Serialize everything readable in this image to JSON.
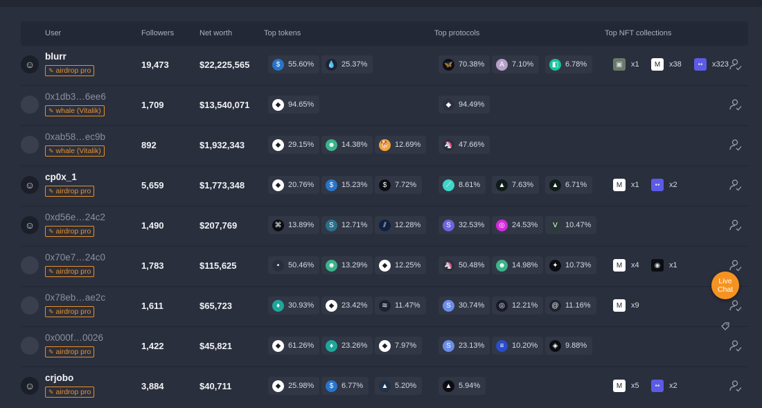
{
  "headers": {
    "user": "User",
    "followers": "Followers",
    "net_worth": "Net worth",
    "top_tokens": "Top tokens",
    "top_protocols": "Top protocols",
    "top_nft": "Top NFT collections"
  },
  "rows": [
    {
      "user": "blurr",
      "style": "strong",
      "avatar": "img",
      "tag": "airdrop pro",
      "followers": "19,473",
      "net_worth": "$22,225,565",
      "tokens": [
        {
          "icon": "usdc-icon",
          "glyph": "$",
          "color": "#2775ca",
          "pct": "55.60%"
        },
        {
          "icon": "drop-icon",
          "glyph": "💧",
          "color": "#1e2433",
          "pct": "25.37%"
        }
      ],
      "protocols": [
        {
          "icon": "butterfly-icon",
          "glyph": "🦋",
          "color": "#0b0d12",
          "pct": "70.38%"
        },
        {
          "icon": "aave-icon",
          "glyph": "A",
          "color": "#b6a0c8",
          "pct": "7.10%"
        },
        {
          "icon": "protocol-green-icon",
          "glyph": "◧",
          "color": "#12c49a",
          "pct": "6.78%"
        }
      ],
      "nfts": [
        {
          "icon": "nft-portrait-icon",
          "glyph": "▣",
          "color": "#6a7a6a",
          "count": "x1"
        },
        {
          "icon": "nft-m-icon",
          "glyph": "M",
          "color": "#ffffff",
          "count": "x38"
        },
        {
          "icon": "nft-eyes-icon",
          "glyph": "••",
          "color": "#5b5be8",
          "count": "x323"
        }
      ]
    },
    {
      "user": "0x1db3…6ee6",
      "style": "addr",
      "avatar": "plain",
      "tag": "whale (Vitalik)",
      "followers": "1,709",
      "net_worth": "$13,540,071",
      "tokens": [
        {
          "icon": "eth-icon",
          "glyph": "◆",
          "color": "#ffffff",
          "pct": "94.65%"
        }
      ],
      "protocols": [
        {
          "icon": "eth-color-icon",
          "glyph": "◆",
          "color": "#2c3040",
          "pct": "94.49%"
        }
      ],
      "nfts": []
    },
    {
      "user": "0xab58…ec9b",
      "style": "addr",
      "avatar": "plain",
      "tag": "whale (Vitalik)",
      "followers": "892",
      "net_worth": "$1,932,343",
      "tokens": [
        {
          "icon": "eth-icon",
          "glyph": "◆",
          "color": "#ffffff",
          "pct": "29.15%"
        },
        {
          "icon": "frog-icon",
          "glyph": "☻",
          "color": "#3bb38a",
          "pct": "14.38%"
        },
        {
          "icon": "shib-icon",
          "glyph": "🐕",
          "color": "#f2a33a",
          "pct": "12.69%"
        }
      ],
      "protocols": [
        {
          "icon": "unicorn-icon",
          "glyph": "🦄",
          "color": "#2a2f3d",
          "pct": "47.66%"
        }
      ],
      "nfts": []
    },
    {
      "user": "cp0x_1",
      "style": "strong",
      "avatar": "img",
      "tag": "airdrop pro",
      "followers": "5,659",
      "net_worth": "$1,773,348",
      "tokens": [
        {
          "icon": "eth-icon",
          "glyph": "◆",
          "color": "#ffffff",
          "pct": "20.76%"
        },
        {
          "icon": "usdc-icon",
          "glyph": "$",
          "color": "#2775ca",
          "pct": "15.23%"
        },
        {
          "icon": "dollar-icon",
          "glyph": "$",
          "color": "#0b0d12",
          "pct": "7.72%"
        }
      ],
      "protocols": [
        {
          "icon": "feather-icon",
          "glyph": "⟋",
          "color": "#3fd5c8",
          "pct": "8.61%"
        },
        {
          "icon": "mountain-icon",
          "glyph": "▲",
          "color": "#0e1c1a",
          "pct": "7.63%"
        },
        {
          "icon": "mountain-icon",
          "glyph": "▲",
          "color": "#0e1c1a",
          "pct": "6.71%"
        }
      ],
      "nfts": [
        {
          "icon": "nft-m-icon",
          "glyph": "M",
          "color": "#ffffff",
          "count": "x1"
        },
        {
          "icon": "nft-eyes-icon",
          "glyph": "••",
          "color": "#5b5be8",
          "count": "x2"
        }
      ]
    },
    {
      "user": "0xd56e…24c2",
      "style": "addr",
      "avatar": "img",
      "tag": "airdrop pro",
      "followers": "1,490",
      "net_worth": "$207,769",
      "tokens": [
        {
          "icon": "square-logo-icon",
          "glyph": "⌘",
          "color": "#0b0d12",
          "pct": "13.89%"
        },
        {
          "icon": "s-token-icon",
          "glyph": "S",
          "color": "#2a6f8a",
          "pct": "12.71%"
        },
        {
          "icon": "stripe-token-icon",
          "glyph": "⫽",
          "color": "#102040",
          "pct": "12.28%"
        }
      ],
      "protocols": [
        {
          "icon": "purple-s-icon",
          "glyph": "S",
          "color": "#6f63e0",
          "pct": "32.53%"
        },
        {
          "icon": "magenta-icon",
          "glyph": "◎",
          "color": "#d12ad8",
          "pct": "24.53%"
        },
        {
          "icon": "vue-icon",
          "glyph": "V",
          "color": "#2a3a38",
          "pct": "10.47%"
        }
      ],
      "nfts": []
    },
    {
      "user": "0x70e7…24c0",
      "style": "addr",
      "avatar": "plain",
      "tag": "airdrop pro",
      "followers": "1,783",
      "net_worth": "$115,625",
      "tokens": [
        {
          "icon": "dark-token-icon",
          "glyph": "•",
          "color": "#2a2f3d",
          "pct": "50.46%"
        },
        {
          "icon": "frog-icon",
          "glyph": "☻",
          "color": "#3bb38a",
          "pct": "13.29%"
        },
        {
          "icon": "eth-icon",
          "glyph": "◆",
          "color": "#ffffff",
          "pct": "12.25%"
        }
      ],
      "protocols": [
        {
          "icon": "unicorn-icon",
          "glyph": "🦄",
          "color": "#2a2f3d",
          "pct": "50.48%"
        },
        {
          "icon": "frog-icon",
          "glyph": "☻",
          "color": "#3bb38a",
          "pct": "14.98%"
        },
        {
          "icon": "wing-icon",
          "glyph": "✦",
          "color": "#0b0d12",
          "pct": "10.73%"
        }
      ],
      "nfts": [
        {
          "icon": "nft-m-icon",
          "glyph": "M",
          "color": "#ffffff",
          "count": "x4"
        },
        {
          "icon": "nft-mask-icon",
          "glyph": "◉",
          "color": "#0b0d12",
          "count": "x1"
        }
      ]
    },
    {
      "user": "0x78eb…ae2c",
      "style": "addr",
      "avatar": "plain",
      "tag": "airdrop pro",
      "followers": "1,611",
      "net_worth": "$65,723",
      "tokens": [
        {
          "icon": "gem-icon",
          "glyph": "♦",
          "color": "#1fa69a",
          "pct": "30.93%"
        },
        {
          "icon": "eth-icon",
          "glyph": "◆",
          "color": "#ffffff",
          "pct": "23.42%"
        },
        {
          "icon": "layers-icon",
          "glyph": "≋",
          "color": "#1e2230",
          "pct": "11.47%"
        }
      ],
      "protocols": [
        {
          "icon": "circle-s-icon",
          "glyph": "S",
          "color": "#6a8de8",
          "pct": "30.74%"
        },
        {
          "icon": "ring-icon",
          "glyph": "◎",
          "color": "#1a1a2e",
          "pct": "12.21%"
        },
        {
          "icon": "spiral-icon",
          "glyph": "@",
          "color": "#1e2230",
          "pct": "11.16%"
        }
      ],
      "nfts": [
        {
          "icon": "nft-m-icon",
          "glyph": "M",
          "color": "#ffffff",
          "count": "x9"
        }
      ]
    },
    {
      "user": "0x000f…0026",
      "style": "addr",
      "avatar": "plain",
      "tag": "airdrop pro",
      "followers": "1,422",
      "net_worth": "$45,821",
      "tokens": [
        {
          "icon": "eth-icon",
          "glyph": "◆",
          "color": "#ffffff",
          "pct": "61.26%"
        },
        {
          "icon": "gem-icon",
          "glyph": "♦",
          "color": "#1fa69a",
          "pct": "23.26%"
        },
        {
          "icon": "eth-icon",
          "glyph": "◆",
          "color": "#ffffff",
          "pct": "7.97%"
        }
      ],
      "protocols": [
        {
          "icon": "circle-s-icon",
          "glyph": "S",
          "color": "#6a8de8",
          "pct": "23.13%"
        },
        {
          "icon": "lines-icon",
          "glyph": "≡",
          "color": "#2a4cc8",
          "pct": "10.20%"
        },
        {
          "icon": "diamond-icon",
          "glyph": "◈",
          "color": "#0b0d12",
          "pct": "9.88%"
        }
      ],
      "nfts": []
    },
    {
      "user": "crjobo",
      "style": "strong",
      "avatar": "img",
      "tag": "airdrop pro",
      "followers": "3,884",
      "net_worth": "$40,711",
      "tokens": [
        {
          "icon": "eth-icon",
          "glyph": "◆",
          "color": "#ffffff",
          "pct": "25.98%"
        },
        {
          "icon": "usdc-icon",
          "glyph": "$",
          "color": "#2775ca",
          "pct": "6.77%"
        },
        {
          "icon": "arb-icon",
          "glyph": "▲",
          "color": "#213147",
          "pct": "5.20%"
        }
      ],
      "protocols": [
        {
          "icon": "arb-icon",
          "glyph": "▲",
          "color": "#0b0d12",
          "pct": "5.94%"
        }
      ],
      "nfts": [
        {
          "icon": "nft-m-icon",
          "glyph": "M",
          "color": "#ffffff",
          "count": "x5"
        },
        {
          "icon": "nft-eyes-icon",
          "glyph": "••",
          "color": "#5b5be8",
          "count": "x2"
        }
      ]
    }
  ],
  "live_chat": "Live Chat",
  "colors": {
    "accent": "#e8902a",
    "bg": "#2a2f3d",
    "header_bg": "#232837",
    "pill_bg": "#323746",
    "chat": "#f59322"
  }
}
